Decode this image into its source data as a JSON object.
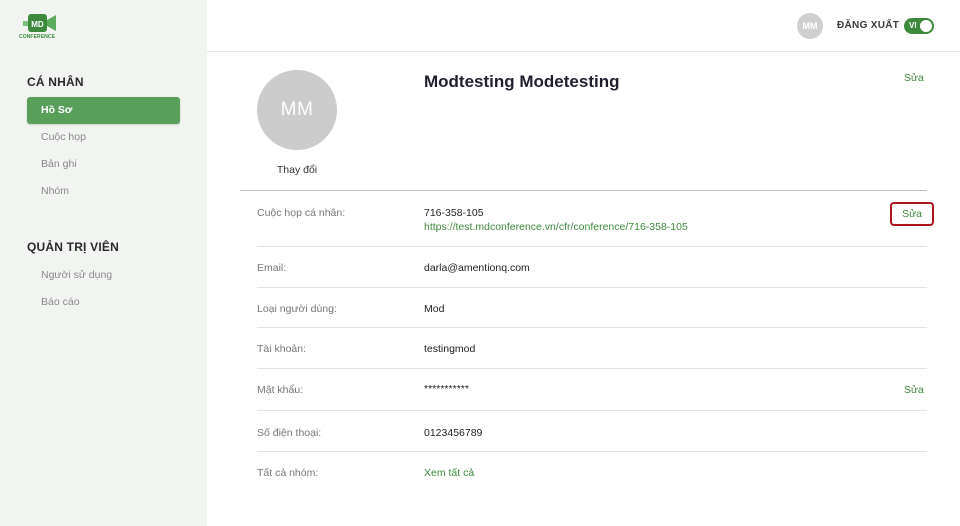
{
  "app": {
    "logo_text": "CONFERENCE",
    "logo_badge": "MD"
  },
  "header": {
    "avatar_initials": "MM",
    "logout_label": "ĐĂNG XUẤT",
    "lang_label": "VI"
  },
  "sidebar": {
    "personal_title": "CÁ NHÂN",
    "personal_items": [
      {
        "label": "Hồ Sơ",
        "active": true
      },
      {
        "label": "Cuộc họp",
        "active": false
      },
      {
        "label": "Bản ghi",
        "active": false
      },
      {
        "label": "Nhóm",
        "active": false
      }
    ],
    "admin_title": "QUẢN TRỊ VIÊN",
    "admin_items": [
      {
        "label": "Người sử dụng"
      },
      {
        "label": "Báo cáo"
      }
    ]
  },
  "profile": {
    "initials": "MM",
    "change_label": "Thay đổi",
    "name": "Modtesting Modetesting",
    "edit_label": "Sửa"
  },
  "fields": {
    "meeting": {
      "label": "Cuộc họp cá nhân:",
      "value": "716-358-105",
      "link": "https://test.mdconference.vn/cfr/conference/716-358-105",
      "edit": "Sửa"
    },
    "email": {
      "label": "Email:",
      "value": "darla@amentionq.com"
    },
    "user_type": {
      "label": "Loại người dùng:",
      "value": "Mod"
    },
    "account": {
      "label": "Tài khoản:",
      "value": "testingmod"
    },
    "password": {
      "label": "Mật khẩu:",
      "value": "***********",
      "edit": "Sửa"
    },
    "phone": {
      "label": "Số điện thoại:",
      "value": "0123456789"
    },
    "groups": {
      "label": "Tất cả nhóm:",
      "link": "Xem tất cả"
    }
  },
  "colors": {
    "accent": "#3d8a3d",
    "active_menu": "#58a05a",
    "highlight_border": "#b0141b"
  }
}
